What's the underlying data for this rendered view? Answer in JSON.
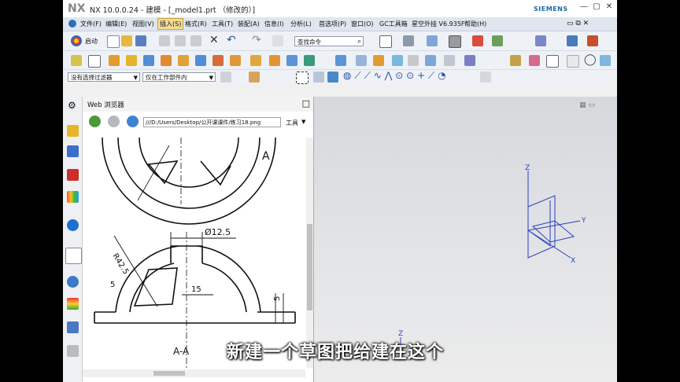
{
  "window": {
    "app_logo": "NX",
    "title": "NX 10.0.0.24 - 建模 - [_model1.prt （修改的）]",
    "brand": "SIEMENS"
  },
  "menu": {
    "items": [
      "文件(F)",
      "编辑(E)",
      "视图(V)",
      "插入(S)",
      "格式(R)",
      "工具(T)",
      "装配(A)",
      "信息(I)",
      "分析(L)",
      "首选项(P)",
      "窗口(O)",
      "GC工具箱",
      "星空外挂 V6.935F",
      "帮助(H)"
    ],
    "active_index": 3
  },
  "toolbar": {
    "start_label": "启动",
    "command_search_placeholder": "查找命令"
  },
  "selection_bar": {
    "filter_value": "没有选择过滤器",
    "scope_value": "仅在工作部件内"
  },
  "web_browser": {
    "title": "Web 浏览器",
    "address": "///D:/Users/Desktop/公开课课件/练习18.png",
    "tools_label": "工具"
  },
  "drawing": {
    "dim_diameter": "Ø12.5",
    "dim_radius": "R42.5",
    "dim_15": "15",
    "dim_5": "5",
    "section_label": "A-A",
    "label_A": "A"
  },
  "viewport": {
    "axis_z": "Z",
    "axis_y": "Y",
    "axis_x": "X"
  },
  "subtitle": "新建一个草图把给建在这个"
}
